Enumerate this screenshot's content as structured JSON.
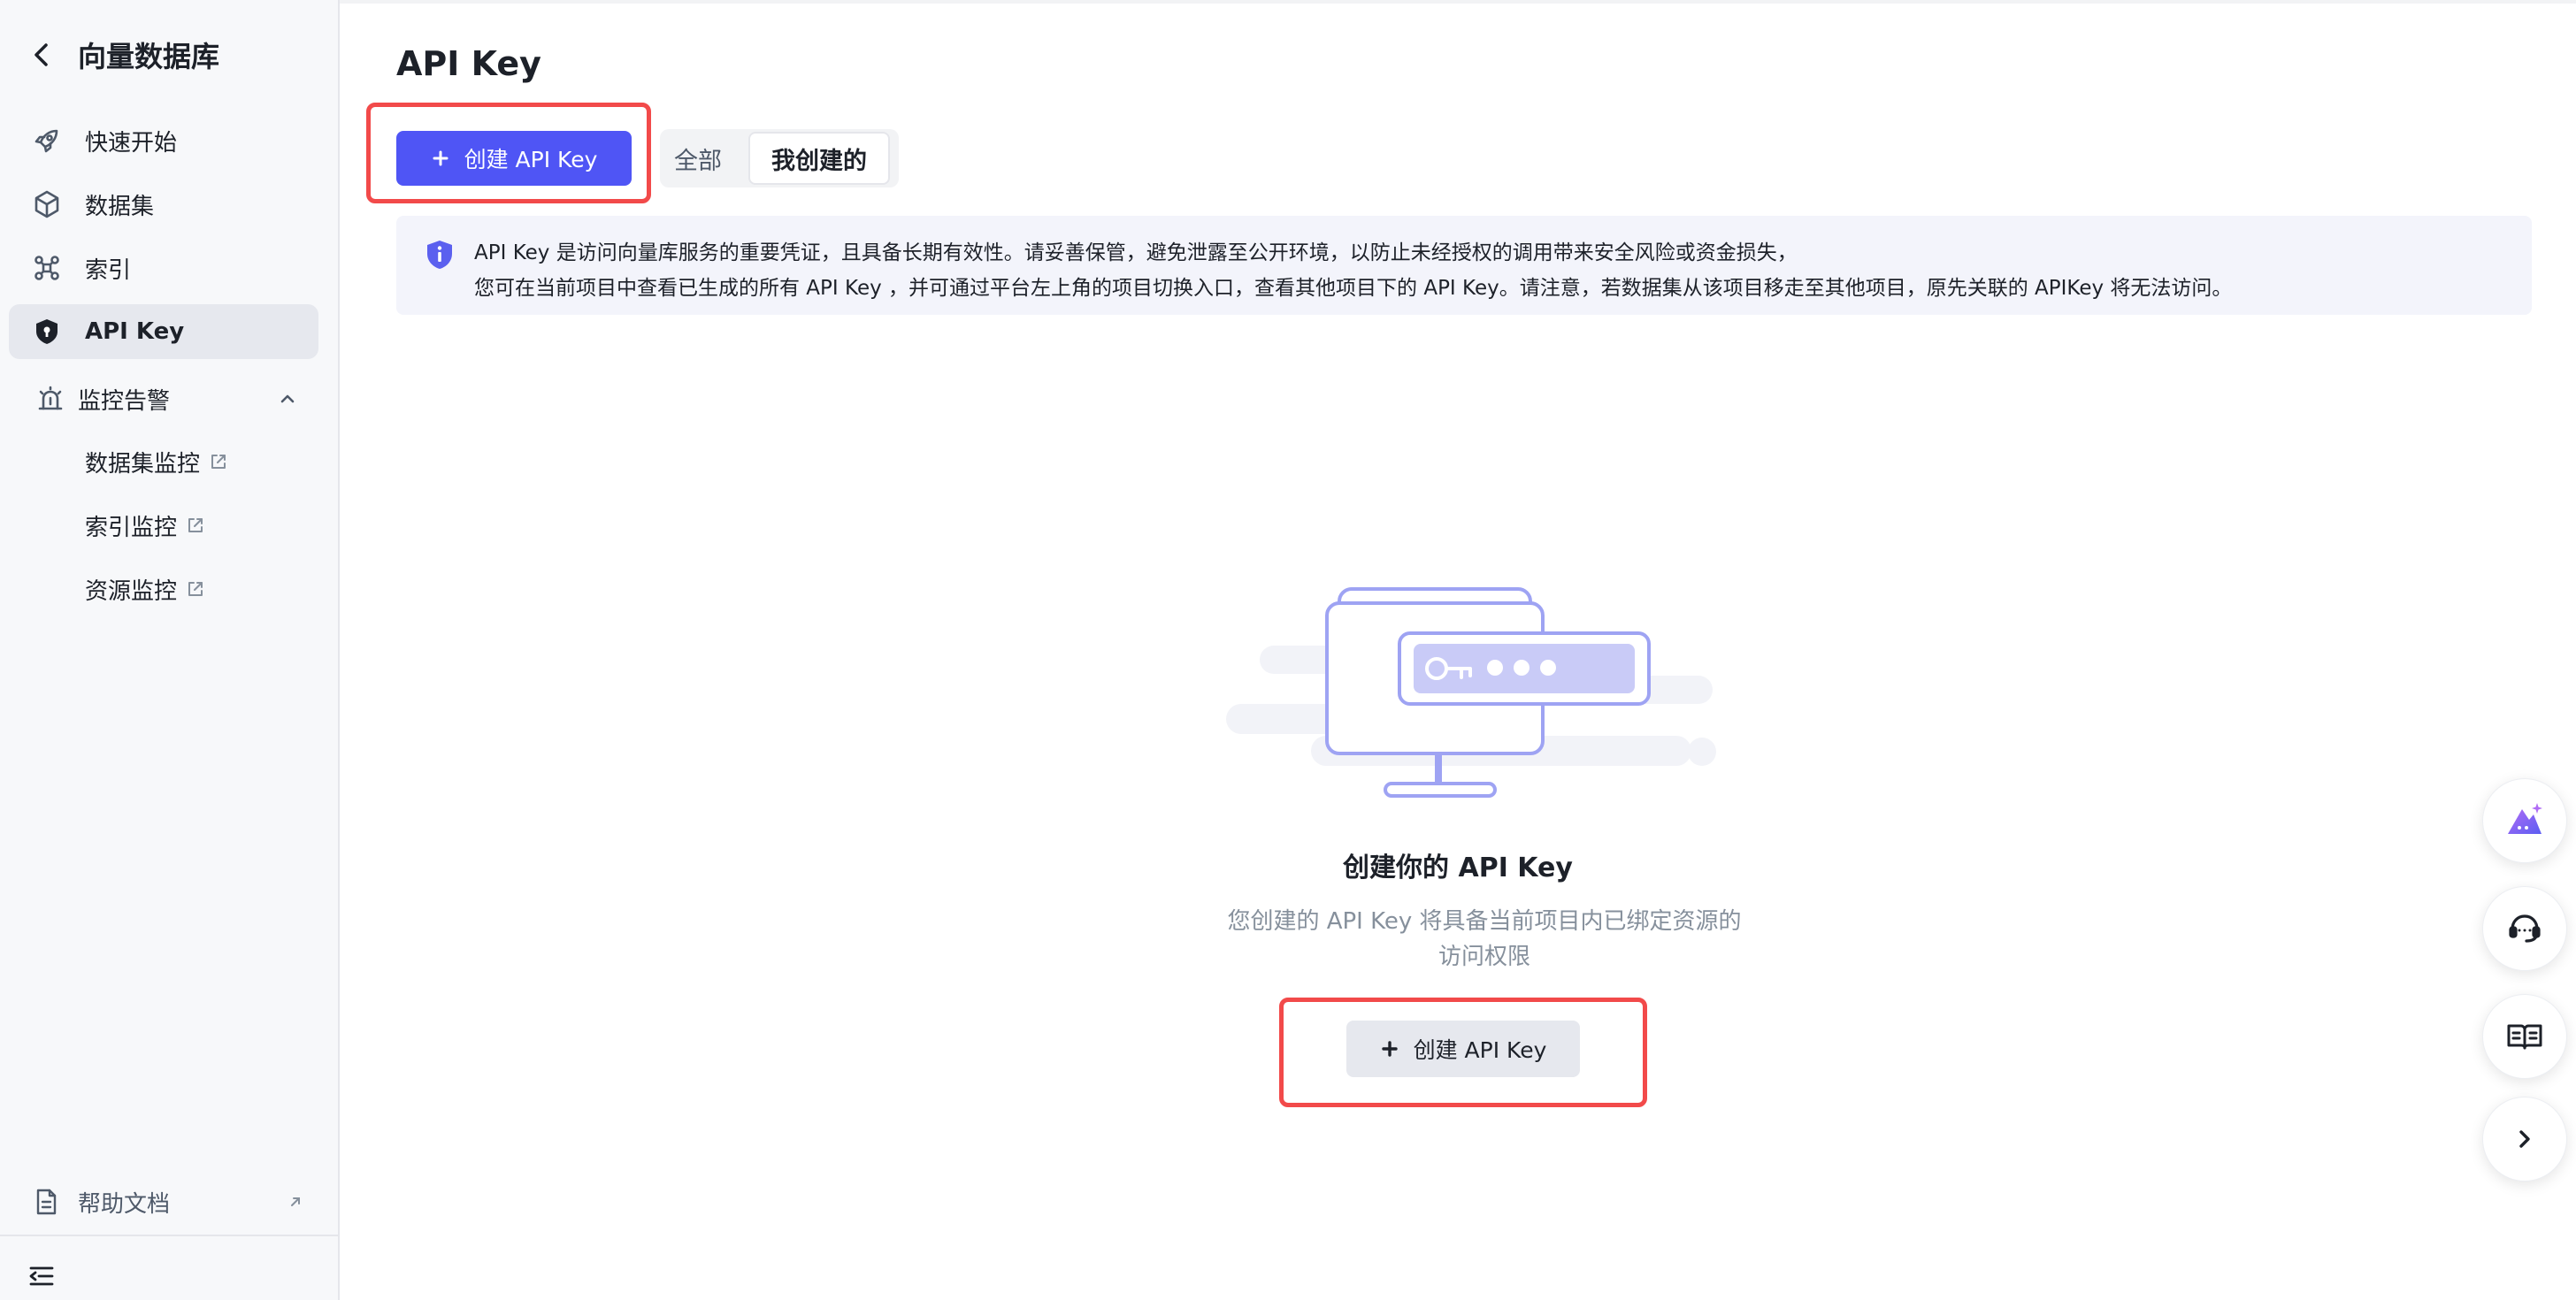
{
  "sidebar": {
    "title": "向量数据库",
    "items": [
      {
        "label": "快速开始"
      },
      {
        "label": "数据集"
      },
      {
        "label": "索引"
      },
      {
        "label": "API Key"
      },
      {
        "label": "监控告警"
      }
    ],
    "sub_items": [
      {
        "label": "数据集监控"
      },
      {
        "label": "索引监控"
      },
      {
        "label": "资源监控"
      }
    ],
    "help_label": "帮助文档"
  },
  "main": {
    "page_title": "API Key",
    "create_button_label": "创建 API Key",
    "tabs": [
      {
        "label": "全部",
        "selected": false
      },
      {
        "label": "我创建的",
        "selected": true
      }
    ],
    "notice": {
      "line1": "API Key 是访问向量库服务的重要凭证，且具备长期有效性。请妥善保管，避免泄露至公开环境，以防止未经授权的调用带来安全风险或资金损失，",
      "line2": "您可在当前项目中查看已生成的所有 API Key ，并可通过平台左上角的项目切换入口，查看其他项目下的 API Key。请注意，若数据集从该项目移走至其他项目，原先关联的 APIKey 将无法访问。"
    },
    "empty_state": {
      "title": "创建你的 API Key",
      "desc_line1": "您创建的 API Key 将具备当前项目内已绑定资源的",
      "desc_line2": "访问权限",
      "button_label": "创建 API Key"
    }
  },
  "icons": {
    "back": "chevron-left-icon",
    "quick_start": "rocket-icon",
    "dataset": "cube-icon",
    "index": "nodes-icon",
    "api_key": "shield-icon",
    "monitor": "alarm-icon",
    "external": "external-link-icon",
    "help": "document-icon",
    "collapse": "collapse-menu-icon",
    "info": "info-shield-icon",
    "ai": "ai-assistant-icon",
    "support": "headset-icon",
    "docs": "book-icon",
    "expand": "chevron-right-icon"
  },
  "colors": {
    "primary": "#4f55f5",
    "highlight": "#f24a4a",
    "sidebar_bg": "#f7f8fa",
    "notice_bg": "#f3f4fb",
    "illustration": "#9ea3f3"
  }
}
